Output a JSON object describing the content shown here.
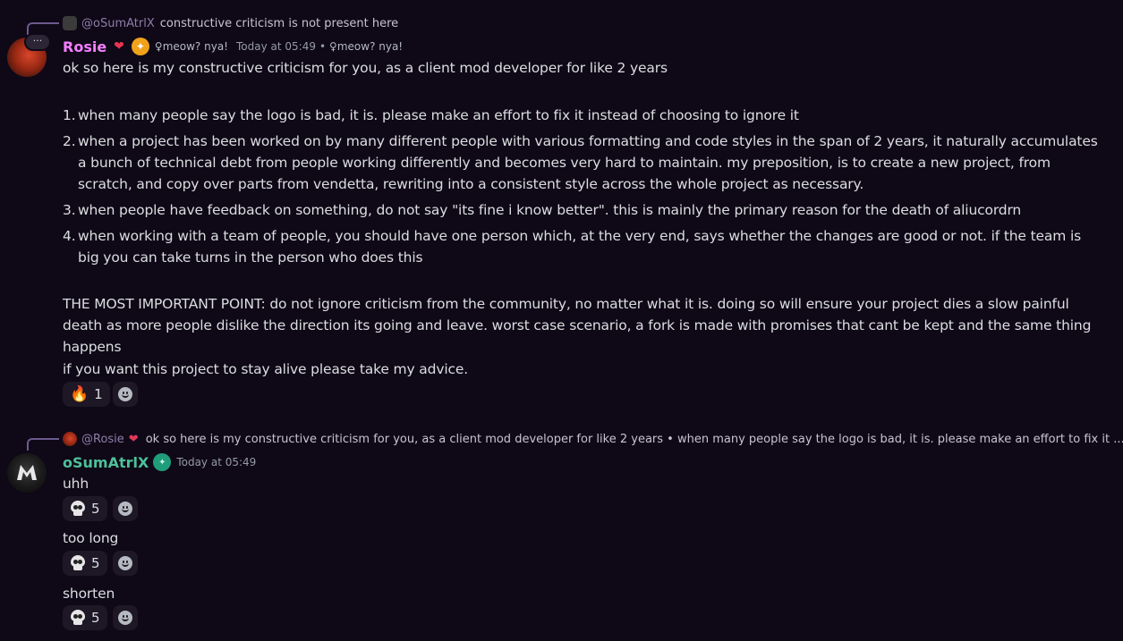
{
  "message1": {
    "reply": {
      "username": "@oSumAtrlX",
      "text": "constructive criticism is not present here"
    },
    "author": {
      "name": "Rosie",
      "role_icon": "❤",
      "tag": "♀meow? nya!",
      "avatar_badge": "···"
    },
    "timestamp": "Today at 05:49",
    "timestamp_sep": "•",
    "tag2": "♀meow? nya!",
    "intro": "ok so here is my constructive criticism for you, as a client mod developer for like 2 years",
    "list": [
      {
        "num": "1.",
        "text": "when many people say the logo is bad, it is. please make an effort to fix it instead of choosing to ignore it"
      },
      {
        "num": "2.",
        "text": "when a project has been worked on by many different people with various formatting and code styles in the span of 2 years, it naturally accumulates a bunch of technical debt from people working differently and becomes very hard to maintain. my preposition, is to create a new project, from scratch, and copy over parts from vendetta, rewriting into a consistent style across the whole project as necessary."
      },
      {
        "num": "3.",
        "text": "when people have feedback on something, do not say \"its fine i know better\". this is mainly the primary reason for the death of aliucordrn"
      },
      {
        "num": "4.",
        "text": "when working with a team of people, you should have one person which, at the very end, says whether the changes are good or not. if the team is big you can take turns in the person who does this"
      }
    ],
    "important": "THE MOST IMPORTANT POINT: do not ignore criticism from the community, no matter what it is. doing so will ensure your project dies a slow painful death as more people dislike the direction its going and leave. worst case scenario, a fork is made with promises that cant be kept and the same thing happens",
    "closing": "if you want this project to stay alive please take my advice.",
    "reaction": {
      "emoji": "🔥",
      "count": "1"
    }
  },
  "message2": {
    "reply": {
      "username": "@Rosie",
      "heart": "❤",
      "text": "ok so here is my constructive criticism for you, as a client mod developer for like 2 years  • when many people say the logo is bad, it is. please make an effort to fix it ..."
    },
    "author": {
      "name": "oSumAtrlX"
    },
    "timestamp": "Today at 05:49",
    "lines": [
      {
        "text": "uhh",
        "reaction_count": "5"
      },
      {
        "text": "too long",
        "reaction_count": "5"
      },
      {
        "text": "shorten",
        "reaction_count": "5"
      }
    ]
  },
  "colors": {
    "background": "#0f0817",
    "rosie_name": "#f47fff",
    "osum_name": "#4ec09a",
    "text": "#dbdee1",
    "reaction_bg": "#1d1726"
  }
}
